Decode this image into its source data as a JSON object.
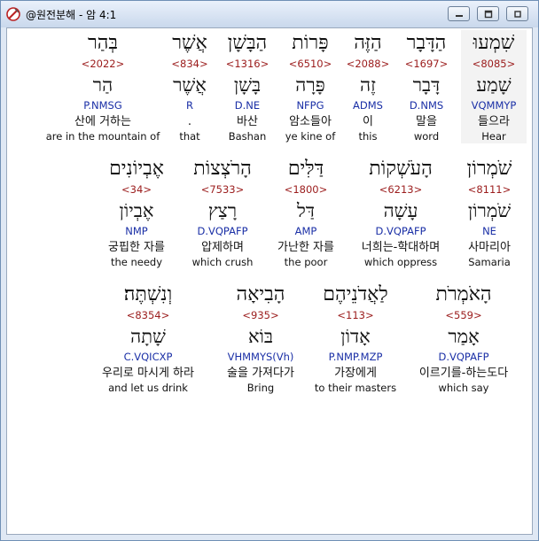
{
  "window": {
    "title": "@원전분해 - 암 4:1",
    "min_icon": "minimize-icon",
    "max_icon": "maximize-icon",
    "close_icon": "close-icon"
  },
  "rows": [
    {
      "words": [
        {
          "heb": "שִׁמְעוּ",
          "strong": "<8085>",
          "lemma": "שָׁמַע",
          "parse": "VQMMYP",
          "kor": "들으라",
          "eng": "Hear",
          "selected": true
        },
        {
          "heb": "הַדָּבָר",
          "strong": "<1697>",
          "lemma": "דָּבָר",
          "parse": "D.NMS",
          "kor": "말을",
          "eng": "word"
        },
        {
          "heb": "הַזֶּה",
          "strong": "<2088>",
          "lemma": "זֶה",
          "parse": "ADMS",
          "kor": "이",
          "eng": "this"
        },
        {
          "heb": "פָּרוֹת",
          "strong": "<6510>",
          "lemma": "פָּרָה",
          "parse": "NFPG",
          "kor": "암소들아",
          "eng": "ye kine of"
        },
        {
          "heb": "הַבָּשָׁן",
          "strong": "<1316>",
          "lemma": "בָּשָׁן",
          "parse": "D.NE",
          "kor": "바산",
          "eng": "Bashan"
        },
        {
          "heb": "אֲשֶׁר",
          "strong": "<834>",
          "lemma": "אֲשֶׁר",
          "parse": "R",
          "kor": "",
          "eng": "that",
          "sub": "."
        },
        {
          "heb": "בְּהַר",
          "strong": "<2022>",
          "lemma": "הַר",
          "parse": "P.NMSG",
          "kor": "산에 거하는",
          "eng": "are in the mountain of"
        }
      ]
    },
    {
      "words": [
        {
          "heb": "שֹׁמְרוֹן",
          "strong": "<8111>",
          "lemma": "שֹׁמְרוֹן",
          "parse": "NE",
          "kor": "사마리아",
          "eng": "Samaria"
        },
        {
          "heb": "הָעֹשְׁקוֹת",
          "strong": "<6213>",
          "lemma": "עָשָׁה",
          "parse": "D.VQPAFP",
          "kor": "너희는-학대하며",
          "eng": "which oppress"
        },
        {
          "heb": "דַּלִּים",
          "strong": "<1800>",
          "lemma": "דַּל",
          "parse": "AMP",
          "kor": "가난한 자를",
          "eng": "the poor"
        },
        {
          "heb": "הָרֹצְצוֹת",
          "strong": "<7533>",
          "lemma": "רָצַץ",
          "parse": "D.VQPAFP",
          "kor": "압제하며",
          "eng": "which crush"
        },
        {
          "heb": "אֶבְיוֹנִים",
          "strong": "<34>",
          "lemma": "אֶבְיוֹן",
          "parse": "NMP",
          "kor": "궁핍한 자를",
          "eng": "the needy"
        }
      ]
    },
    {
      "words": [
        {
          "heb": "הָאֹמְרֹת",
          "strong": "<559>",
          "lemma": "אָמַר",
          "parse": "D.VQPAFP",
          "kor": "이르기를-하는도다",
          "eng": "which say"
        },
        {
          "heb": "לַאֲדֹנֵיהֶם",
          "strong": "<113>",
          "lemma": "אָדוֹן",
          "parse": "P.NMP.MZP",
          "kor": "가장에게",
          "eng": "to their masters"
        },
        {
          "heb": "הָבִיאָה",
          "strong": "<935>",
          "lemma": "בּוֹא",
          "parse": "VHMMYS(Vh)",
          "kor": "술을 가져다가",
          "eng": "Bring"
        },
        {
          "heb": "וְנִשְׁתֶּה׃",
          "strong": "<8354>",
          "lemma": "שָׁתָה",
          "parse": "C.VQICXP",
          "kor": "우리로 마시게 하라",
          "eng": "and let us drink"
        }
      ]
    }
  ]
}
